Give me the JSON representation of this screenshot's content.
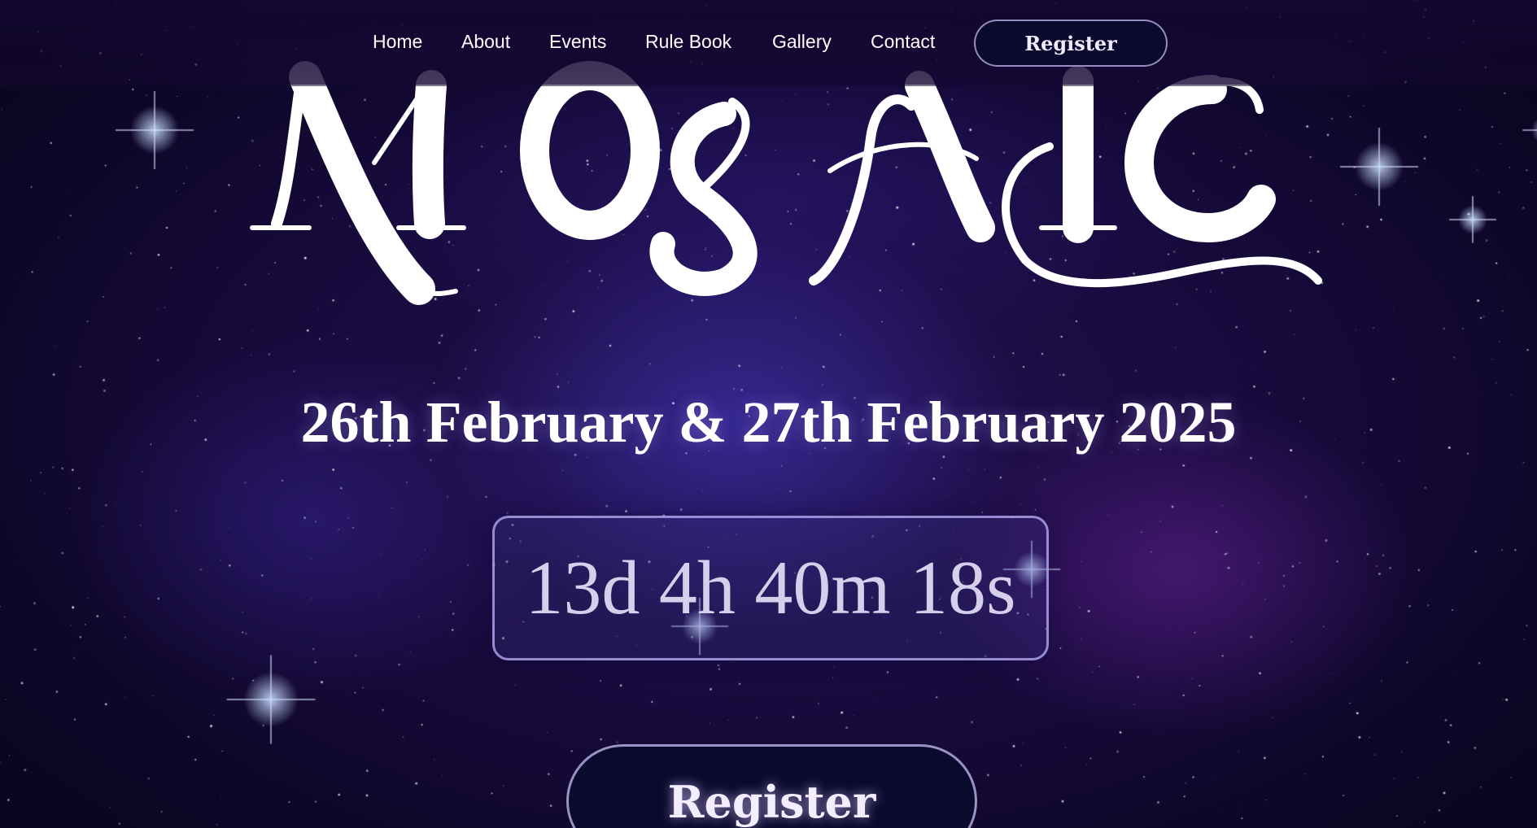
{
  "nav": {
    "items": [
      {
        "label": "Home"
      },
      {
        "label": "About"
      },
      {
        "label": "Events"
      },
      {
        "label": "Rule Book"
      },
      {
        "label": "Gallery"
      },
      {
        "label": "Contact"
      }
    ],
    "register_label": "Register"
  },
  "hero": {
    "logo_text": "MOSAIC",
    "date_text": "26th February & 27th February 2025",
    "countdown": {
      "days": 13,
      "hours": 4,
      "minutes": 40,
      "seconds": 18,
      "display": "13d 4h 40m 18s"
    },
    "register_label": "Register"
  },
  "colors": {
    "background": "#160a3a",
    "text": "#ffffff",
    "countdown_text": "#d4d0ec",
    "button_bg": "#0a0a2e",
    "button_border": "#beb4eb"
  }
}
